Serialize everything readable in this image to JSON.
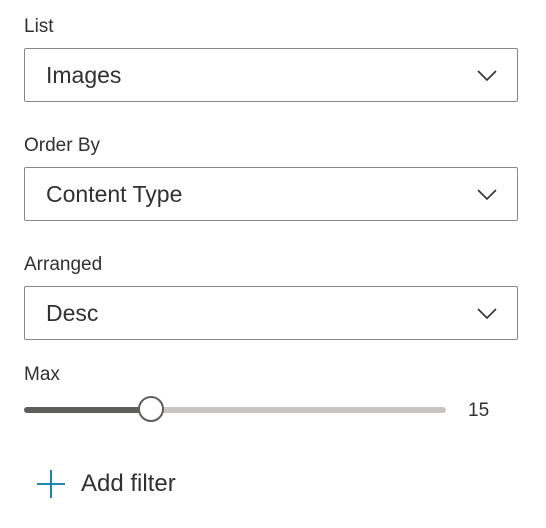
{
  "fields": {
    "list": {
      "label": "List",
      "value": "Images",
      "icon": "chevron-down-icon"
    },
    "order_by": {
      "label": "Order By",
      "value": "Content Type",
      "icon": "chevron-down-icon"
    },
    "arranged": {
      "label": "Arranged",
      "value": "Desc",
      "icon": "chevron-down-icon"
    }
  },
  "max": {
    "label": "Max",
    "value": "15",
    "fill_fraction": 0.3
  },
  "add_filter": {
    "label": "Add filter",
    "icon": "plus-icon",
    "icon_color": "#0078a8"
  },
  "colors": {
    "text": "#323130",
    "border": "#8a8886",
    "slider_fill": "#605e5c",
    "slider_track": "#c8c6c4"
  }
}
